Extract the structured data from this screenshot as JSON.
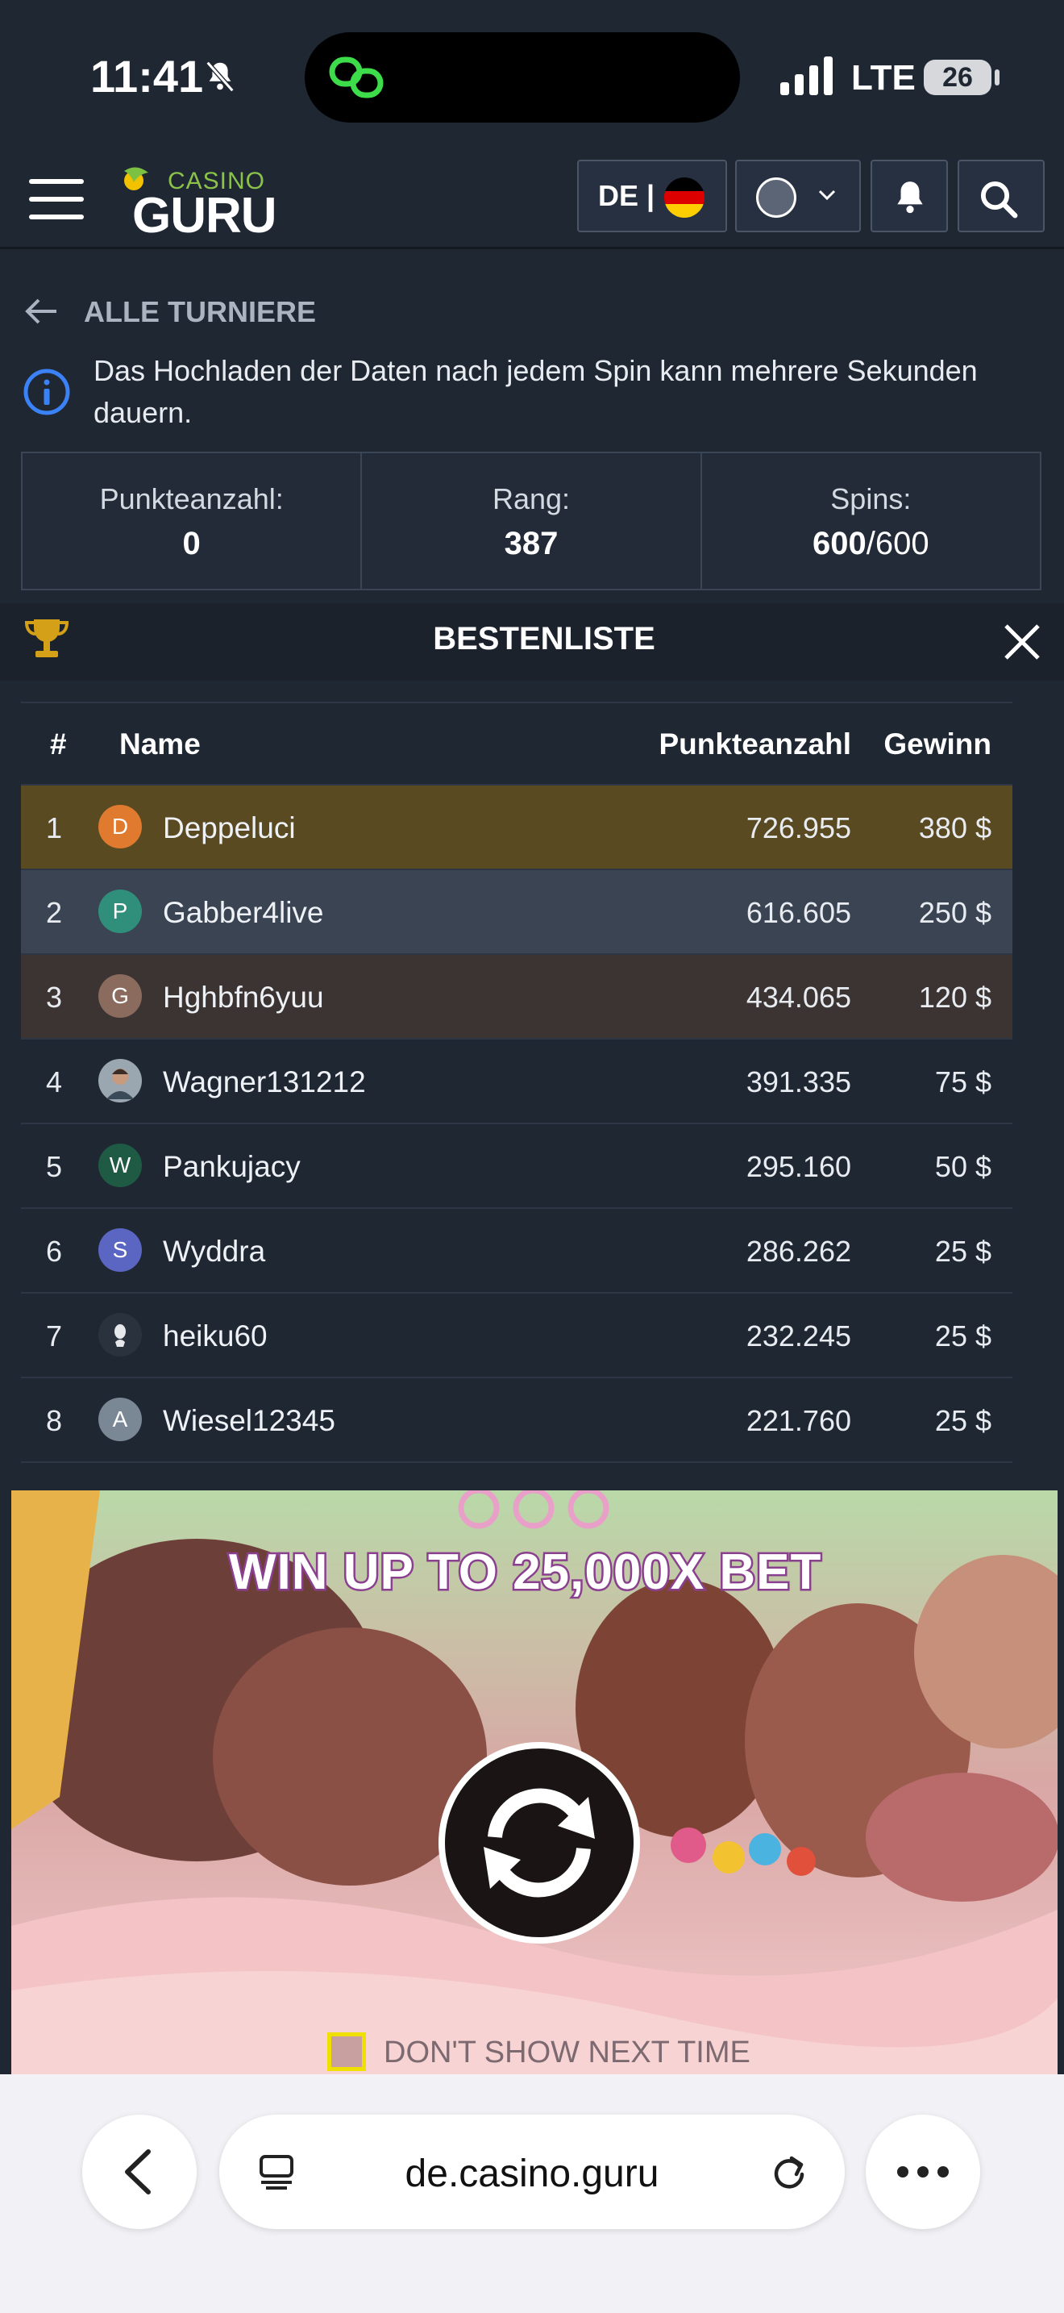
{
  "status_bar": {
    "time": "11:41",
    "network": "LTE",
    "battery": "26"
  },
  "header": {
    "logo_top": "CASINO",
    "logo_bottom": "GURU",
    "language": "DE |"
  },
  "back_link": "ALLE TURNIERE",
  "info": "Das Hochladen der Daten nach jedem Spin kann mehrere Sekunden dauern.",
  "stats": {
    "points_label": "Punkteanzahl:",
    "points_value": "0",
    "rank_label": "Rang:",
    "rank_value": "387",
    "spins_label": "Spins:",
    "spins_used": "600",
    "spins_total": "/600"
  },
  "leaderboard": {
    "title": "BESTENLISTE",
    "columns": {
      "rank": "#",
      "name": "Name",
      "points": "Punkteanzahl",
      "prize": "Gewinn"
    },
    "rows": [
      {
        "rank": "1",
        "initial": "D",
        "avatar_color": "#e07a2e",
        "name": "Deppeluci",
        "points": "726.955",
        "prize": "380 $"
      },
      {
        "rank": "2",
        "initial": "P",
        "avatar_color": "#2f8f7a",
        "name": "Gabber4live",
        "points": "616.605",
        "prize": "250 $"
      },
      {
        "rank": "3",
        "initial": "G",
        "avatar_color": "#8a6b5e",
        "name": "Hghbfn6yuu",
        "points": "434.065",
        "prize": "120 $"
      },
      {
        "rank": "4",
        "initial": "",
        "avatar_color": "#6b7c8a",
        "name": "Wagner131212",
        "points": "391.335",
        "prize": "75 $"
      },
      {
        "rank": "5",
        "initial": "W",
        "avatar_color": "#1f5a44",
        "name": "Pankujacy",
        "points": "295.160",
        "prize": "50 $"
      },
      {
        "rank": "6",
        "initial": "S",
        "avatar_color": "#5a66c2",
        "name": "Wyddra",
        "points": "286.262",
        "prize": "25 $"
      },
      {
        "rank": "7",
        "initial": "",
        "avatar_color": "#2a323d",
        "name": "heiku60",
        "points": "232.245",
        "prize": "25 $"
      },
      {
        "rank": "8",
        "initial": "A",
        "avatar_color": "#7a8896",
        "name": "Wiesel12345",
        "points": "221.760",
        "prize": "25 $"
      }
    ]
  },
  "game": {
    "headline": "WIN UP TO 25,000X BET",
    "dont_show": "DON'T SHOW NEXT TIME"
  },
  "browser": {
    "url": "de.casino.guru"
  }
}
